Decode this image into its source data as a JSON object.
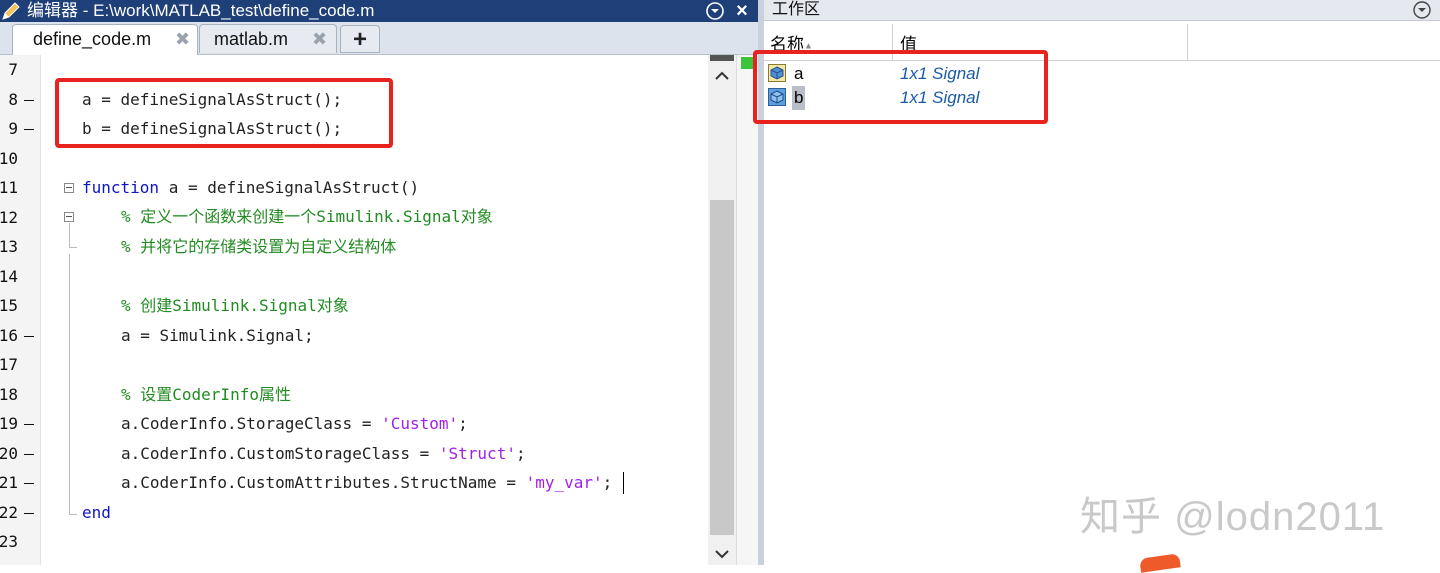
{
  "editor": {
    "title": "编辑器 - E:\\work\\MATLAB_test\\define_code.m",
    "tabs": [
      {
        "label": "define_code.m",
        "close": "✖"
      },
      {
        "label": "matlab.m",
        "close": "✖"
      }
    ],
    "add_tab": "+",
    "line_numbers": [
      "7",
      "8",
      "9",
      "10",
      "11",
      "12",
      "13",
      "14",
      "15",
      "16",
      "17",
      "18",
      "19",
      "20",
      "21",
      "22",
      "23"
    ],
    "code": {
      "l8": "a = defineSignalAsStruct();",
      "l9": "b = defineSignalAsStruct();",
      "l11_kw": "function",
      "l11_rest": " a = defineSignalAsStruct()",
      "l12": "% 定义一个函数来创建一个Simulink.Signal对象",
      "l13": "% 并将它的存储类设置为自定义结构体",
      "l15": "% 创建Simulink.Signal对象",
      "l16": "a = Simulink.Signal;",
      "l18": "% 设置CoderInfo属性",
      "l19_code": "a.CoderInfo.StorageClass = ",
      "l19_str": "'Custom'",
      "l19_end": ";",
      "l20_code": "a.CoderInfo.CustomStorageClass = ",
      "l20_str": "'Struct'",
      "l20_end": ";",
      "l21_code": "a.CoderInfo.CustomAttributes.StructName = ",
      "l21_str": "'my_var'",
      "l21_end": ";",
      "l22": "end"
    }
  },
  "workspace": {
    "title": "工作区",
    "columns": {
      "name": "名称",
      "value": "值"
    },
    "sort_indicator": "▲",
    "variables": [
      {
        "name": "a",
        "value": "1x1 Signal"
      },
      {
        "name": "b",
        "value": "1x1 Signal"
      }
    ]
  },
  "watermark": "知乎 @lodn2011",
  "colors": {
    "title_bar": "#1e3f77",
    "keyword": "#0e15c7",
    "comment": "#228b22",
    "string": "#a020f0",
    "annotation_box": "#e8231f"
  }
}
